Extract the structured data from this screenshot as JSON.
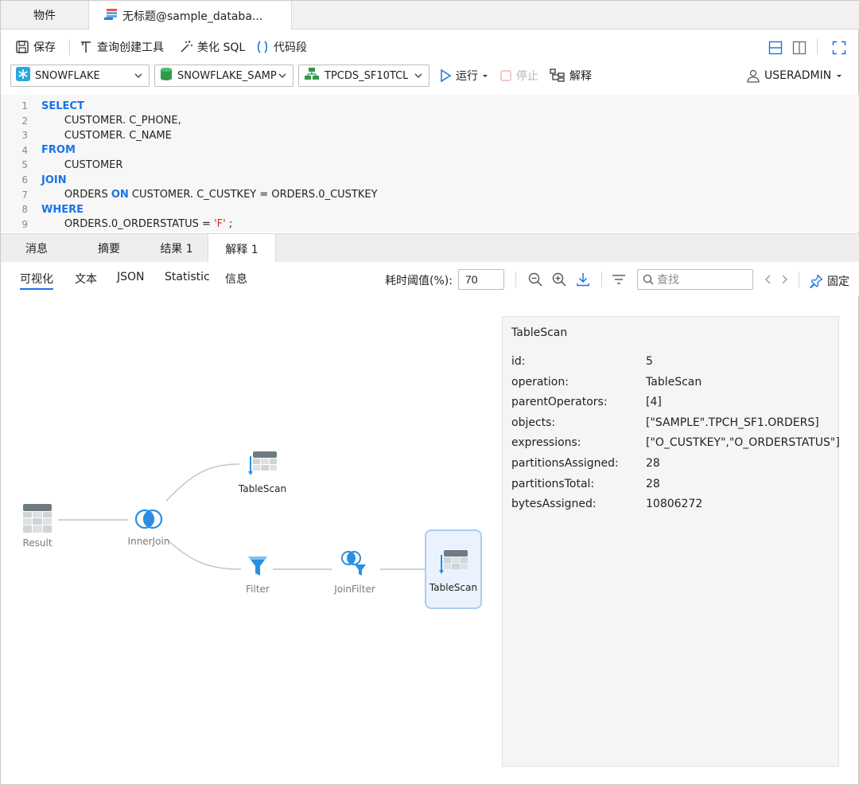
{
  "tabs": {
    "objects": "物件",
    "query_tab": "无标题@sample_databa..."
  },
  "toolbar": {
    "save": "保存",
    "query_builder": "查询创建工具",
    "beautify_sql": "美化 SQL",
    "code_snippet": "代码段"
  },
  "connection": {
    "warehouse": "SNOWFLAKE",
    "database": "SNOWFLAKE_SAMP",
    "schema": "TPCDS_SF10TCL",
    "run": "运行",
    "stop": "停止",
    "explain": "解释",
    "user": "USERADMIN"
  },
  "editor": {
    "lines": [
      {
        "n": "1",
        "parts": [
          {
            "t": "SELECT",
            "k": "kw"
          }
        ]
      },
      {
        "n": "2",
        "parts": [
          {
            "t": "       CUSTOMER. C_PHONE,",
            "k": ""
          }
        ]
      },
      {
        "n": "3",
        "parts": [
          {
            "t": "       CUSTOMER. C_NAME",
            "k": ""
          }
        ]
      },
      {
        "n": "4",
        "parts": [
          {
            "t": "FROM",
            "k": "kw"
          }
        ]
      },
      {
        "n": "5",
        "parts": [
          {
            "t": "       CUSTOMER",
            "k": ""
          }
        ]
      },
      {
        "n": "6",
        "parts": [
          {
            "t": "JOIN",
            "k": "kw"
          }
        ]
      },
      {
        "n": "7",
        "parts": [
          {
            "t": "       ORDERS ",
            "k": ""
          },
          {
            "t": "ON",
            "k": "kw"
          },
          {
            "t": " CUSTOMER. C_CUSTKEY = ORDERS.0_CUSTKEY",
            "k": ""
          }
        ]
      },
      {
        "n": "8",
        "parts": [
          {
            "t": "WHERE",
            "k": "kw"
          }
        ]
      },
      {
        "n": "9",
        "parts": [
          {
            "t": "       ORDERS.0_ORDERSTATUS = ",
            "k": ""
          },
          {
            "t": "'F'",
            "k": "str"
          },
          {
            "t": " ;",
            "k": ""
          }
        ]
      }
    ]
  },
  "result_tabs": {
    "messages": "消息",
    "summary": "摘要",
    "result1": "结果 1",
    "explain1": "解释 1"
  },
  "view_tabs": {
    "visual": "可视化",
    "text": "文本",
    "json": "JSON",
    "statistic": "Statistic",
    "info": "信息"
  },
  "threshold": {
    "label": "耗时阈值(%):",
    "value": "70"
  },
  "search": {
    "placeholder": "查找"
  },
  "pin": "固定",
  "plan_nodes": {
    "result": "Result",
    "inner_join": "InnerJoin",
    "table_scan_top": "TableScan",
    "filter": "Filter",
    "join_filter": "JoinFilter",
    "table_scan_selected": "TableScan"
  },
  "detail": {
    "title": "TableScan",
    "props": [
      {
        "key": "id:",
        "value": "5"
      },
      {
        "key": "operation:",
        "value": "TableScan"
      },
      {
        "key": "parentOperators:",
        "value": "[4]"
      },
      {
        "key": "objects:",
        "value": "[\"SAMPLE\".TPCH_SF1.ORDERS]"
      },
      {
        "key": "expressions:",
        "value": "[\"O_CUSTKEY\",\"O_ORDERSTATUS\"]"
      },
      {
        "key": "partitionsAssigned:",
        "value": "28"
      },
      {
        "key": "partitionsTotal:",
        "value": "28"
      },
      {
        "key": "bytesAssigned:",
        "value": "10806272"
      }
    ]
  },
  "colors": {
    "accent": "#1a73e8",
    "keyword": "#1a73e8",
    "string": "#d93025"
  }
}
